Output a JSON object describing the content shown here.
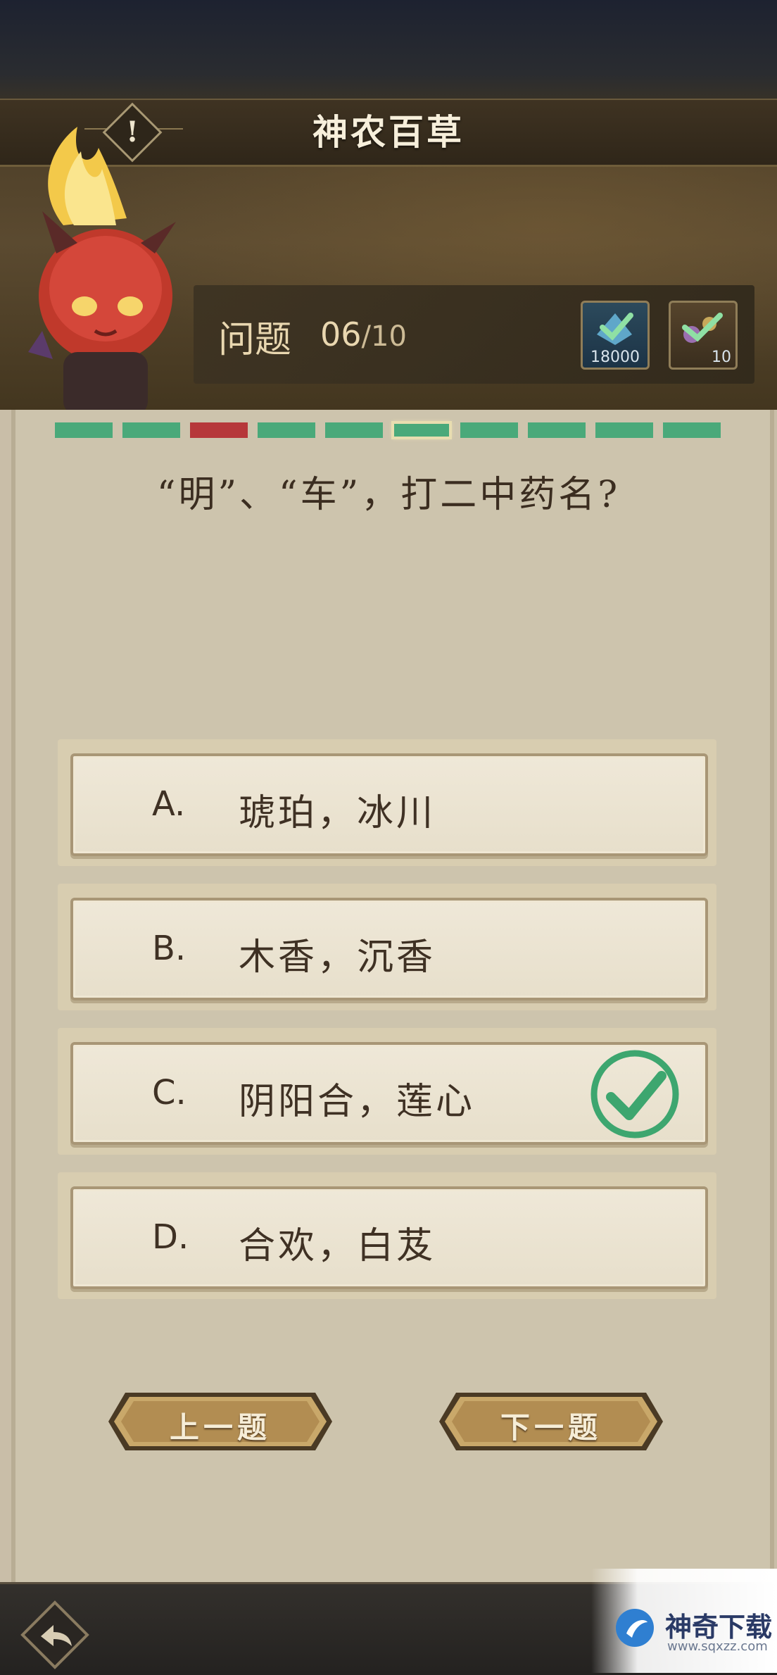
{
  "header": {
    "title": "神农百草",
    "info_icon_glyph": "!"
  },
  "question_panel": {
    "label": "问题",
    "current": "06",
    "total": "/10",
    "badges": [
      {
        "icon": "check-crystal-icon",
        "value": "18000"
      },
      {
        "icon": "check-herb-icon",
        "value": "10"
      }
    ]
  },
  "progress": [
    {
      "state": "correct"
    },
    {
      "state": "correct"
    },
    {
      "state": "wrong"
    },
    {
      "state": "correct"
    },
    {
      "state": "correct"
    },
    {
      "state": "current"
    },
    {
      "state": "correct"
    },
    {
      "state": "correct"
    },
    {
      "state": "correct"
    },
    {
      "state": "correct"
    }
  ],
  "question": {
    "text": "“明”、“车”，打二中药名?"
  },
  "options": [
    {
      "letter": "A.",
      "text": "琥珀，冰川",
      "correct": false
    },
    {
      "letter": "B.",
      "text": "木香，沉香",
      "correct": false
    },
    {
      "letter": "C.",
      "text": "阴阳合，莲心",
      "correct": true
    },
    {
      "letter": "D.",
      "text": "合欢，白芨",
      "correct": false
    }
  ],
  "nav": {
    "prev_label": "上一题",
    "next_label": "下一题"
  },
  "footer": {
    "back_icon": "back-arrow-icon"
  },
  "watermark": {
    "title": "神奇下载",
    "url": "www.sqxzz.com"
  },
  "colors": {
    "correct": "#4aa97a",
    "wrong": "#b6373a",
    "panel": "#cdc4ad",
    "text_dark": "#3f3124"
  }
}
